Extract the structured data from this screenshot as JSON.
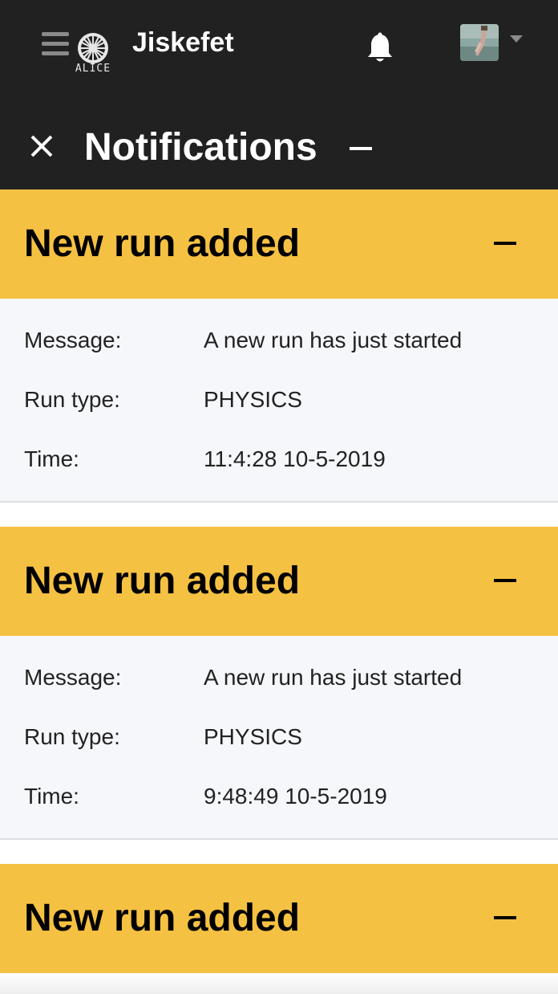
{
  "app": {
    "title": "Jiskefet",
    "logo_text": "ALICE"
  },
  "panel": {
    "title": "Notifications"
  },
  "colors": {
    "topbar": "#212121",
    "accent": "#f5c142",
    "card_body": "#f6f7fa"
  },
  "icons": [
    "hamburger-icon",
    "alice-logo",
    "bell-icon",
    "avatar",
    "chevron-down-icon",
    "close-icon",
    "minus-icon"
  ],
  "notifications": [
    {
      "title": "New run added",
      "rows": [
        {
          "label": "Message:",
          "value": "A new run has just started"
        },
        {
          "label": "Run type:",
          "value": "PHYSICS"
        },
        {
          "label": "Time:",
          "value": "11:4:28 10-5-2019"
        }
      ]
    },
    {
      "title": "New run added",
      "rows": [
        {
          "label": "Message:",
          "value": "A new run has just started"
        },
        {
          "label": "Run type:",
          "value": "PHYSICS"
        },
        {
          "label": "Time:",
          "value": "9:48:49 10-5-2019"
        }
      ]
    },
    {
      "title": "New run added",
      "rows": []
    }
  ]
}
